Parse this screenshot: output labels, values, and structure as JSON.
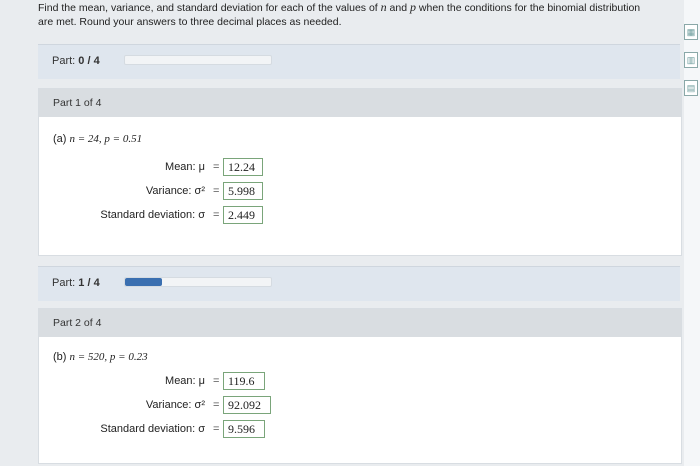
{
  "prompt": {
    "line1_a": "Find the mean, variance, and standard deviation for each of the values of ",
    "var_n": "n",
    "line1_b": " and ",
    "var_p": "p",
    "line1_c": " when the conditions for the binomial distribution",
    "line2": "are met. Round your answers to three decimal places as needed."
  },
  "progress_top": {
    "label": "Part:",
    "value": "0 / 4",
    "fraction": 0.0
  },
  "part1": {
    "header": "Part 1 of 4",
    "question_prefix": "(a) ",
    "question_math": "n = 24, p = 0.51",
    "mean_label": "Mean: μ",
    "variance_label": "Variance: σ²",
    "sd_label": "Standard deviation: σ",
    "eq": "=",
    "mean": "12.24",
    "variance": "5.998",
    "sd": "2.449"
  },
  "progress_mid": {
    "label": "Part:",
    "value": "1 / 4",
    "fraction": 0.25
  },
  "part2": {
    "header": "Part 2 of 4",
    "question_prefix": "(b) ",
    "question_math": "n = 520, p = 0.23",
    "mean_label": "Mean: μ",
    "variance_label": "Variance: σ²",
    "sd_label": "Standard deviation: σ",
    "eq": "=",
    "mean": "119.6",
    "variance": "92.092",
    "sd": "9.596"
  },
  "colors": {
    "accent": "#3a6fb0",
    "answer_border": "#7aa57a",
    "part_bar": "#dfe6ee"
  }
}
